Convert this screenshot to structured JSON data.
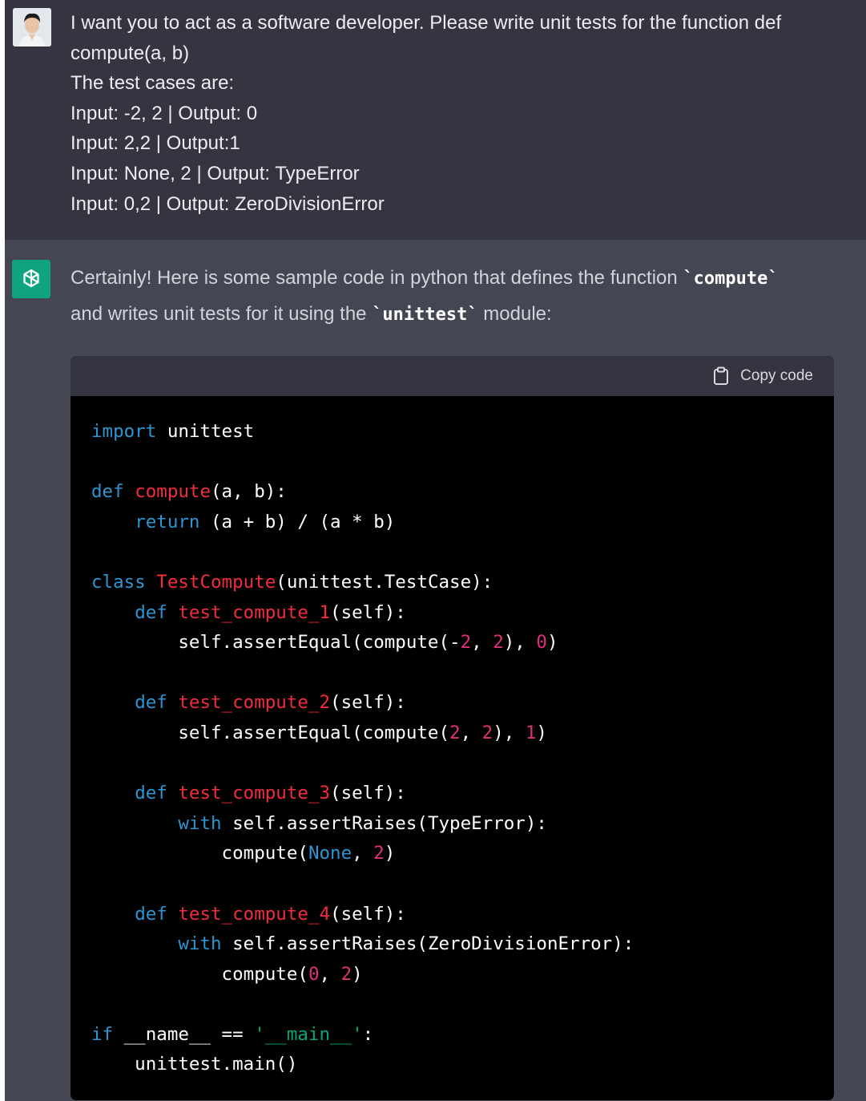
{
  "user_message": {
    "lines": [
      "I want you to act as a software developer. Please write unit tests for the function def",
      "compute(a, b)",
      "The test cases are:",
      "Input: -2, 2 | Output: 0",
      "Input: 2,2 | Output:1",
      "Input: None, 2 | Output: TypeError",
      "Input: 0,2 | Output: ZeroDivisionError"
    ]
  },
  "assistant_message": {
    "intro_part1": "Certainly! Here is some sample code in python that defines the function ",
    "intro_code1": "`compute`",
    "intro_part2": "and writes unit tests for it using the ",
    "intro_code2": "`unittest`",
    "intro_part3": " module:",
    "code_block": {
      "copy_label": "Copy code",
      "lines": [
        [
          {
            "t": "import",
            "c": "kw"
          },
          {
            "t": " unittest",
            "c": "plain"
          }
        ],
        [],
        [
          {
            "t": "def",
            "c": "kw"
          },
          {
            "t": " ",
            "c": "plain"
          },
          {
            "t": "compute",
            "c": "fn"
          },
          {
            "t": "(a, b):",
            "c": "plain"
          }
        ],
        [
          {
            "t": "    ",
            "c": "plain"
          },
          {
            "t": "return",
            "c": "kw"
          },
          {
            "t": " (a + b) / (a * b)",
            "c": "plain"
          }
        ],
        [],
        [
          {
            "t": "class",
            "c": "kw"
          },
          {
            "t": " ",
            "c": "plain"
          },
          {
            "t": "TestCompute",
            "c": "fn"
          },
          {
            "t": "(unittest.TestCase):",
            "c": "plain"
          }
        ],
        [
          {
            "t": "    ",
            "c": "plain"
          },
          {
            "t": "def",
            "c": "kw"
          },
          {
            "t": " ",
            "c": "plain"
          },
          {
            "t": "test_compute_1",
            "c": "fn"
          },
          {
            "t": "(self):",
            "c": "plain"
          }
        ],
        [
          {
            "t": "        self.assertEqual(compute(-",
            "c": "plain"
          },
          {
            "t": "2",
            "c": "num"
          },
          {
            "t": ", ",
            "c": "plain"
          },
          {
            "t": "2",
            "c": "num"
          },
          {
            "t": "), ",
            "c": "plain"
          },
          {
            "t": "0",
            "c": "num"
          },
          {
            "t": ")",
            "c": "plain"
          }
        ],
        [],
        [
          {
            "t": "    ",
            "c": "plain"
          },
          {
            "t": "def",
            "c": "kw"
          },
          {
            "t": " ",
            "c": "plain"
          },
          {
            "t": "test_compute_2",
            "c": "fn"
          },
          {
            "t": "(self):",
            "c": "plain"
          }
        ],
        [
          {
            "t": "        self.assertEqual(compute(",
            "c": "plain"
          },
          {
            "t": "2",
            "c": "num"
          },
          {
            "t": ", ",
            "c": "plain"
          },
          {
            "t": "2",
            "c": "num"
          },
          {
            "t": "), ",
            "c": "plain"
          },
          {
            "t": "1",
            "c": "num"
          },
          {
            "t": ")",
            "c": "plain"
          }
        ],
        [],
        [
          {
            "t": "    ",
            "c": "plain"
          },
          {
            "t": "def",
            "c": "kw"
          },
          {
            "t": " ",
            "c": "plain"
          },
          {
            "t": "test_compute_3",
            "c": "fn"
          },
          {
            "t": "(self):",
            "c": "plain"
          }
        ],
        [
          {
            "t": "        ",
            "c": "plain"
          },
          {
            "t": "with",
            "c": "kw"
          },
          {
            "t": " self.assertRaises(TypeError):",
            "c": "plain"
          }
        ],
        [
          {
            "t": "            compute(",
            "c": "plain"
          },
          {
            "t": "None",
            "c": "kw"
          },
          {
            "t": ", ",
            "c": "plain"
          },
          {
            "t": "2",
            "c": "num"
          },
          {
            "t": ")",
            "c": "plain"
          }
        ],
        [],
        [
          {
            "t": "    ",
            "c": "plain"
          },
          {
            "t": "def",
            "c": "kw"
          },
          {
            "t": " ",
            "c": "plain"
          },
          {
            "t": "test_compute_4",
            "c": "fn"
          },
          {
            "t": "(self):",
            "c": "plain"
          }
        ],
        [
          {
            "t": "        ",
            "c": "plain"
          },
          {
            "t": "with",
            "c": "kw"
          },
          {
            "t": " self.assertRaises(ZeroDivisionError):",
            "c": "plain"
          }
        ],
        [
          {
            "t": "            compute(",
            "c": "plain"
          },
          {
            "t": "0",
            "c": "num"
          },
          {
            "t": ", ",
            "c": "plain"
          },
          {
            "t": "2",
            "c": "num"
          },
          {
            "t": ")",
            "c": "plain"
          }
        ],
        [],
        [
          {
            "t": "if",
            "c": "kw"
          },
          {
            "t": " __name__ == ",
            "c": "plain"
          },
          {
            "t": "'__main__'",
            "c": "str"
          },
          {
            "t": ":",
            "c": "plain"
          }
        ],
        [
          {
            "t": "    unittest.main()",
            "c": "plain"
          }
        ]
      ]
    }
  },
  "colors": {
    "user_bg": "#343541",
    "assistant_bg": "#444654",
    "code_bg": "#000000",
    "keyword": "#2e95d3",
    "function_name": "#f22c3d",
    "number": "#df3079",
    "string": "#00a67d",
    "brand": "#10a37f"
  },
  "icons": {
    "user_avatar": "user-avatar-photo",
    "bot_avatar": "openai-logo-icon",
    "copy": "clipboard-icon"
  }
}
